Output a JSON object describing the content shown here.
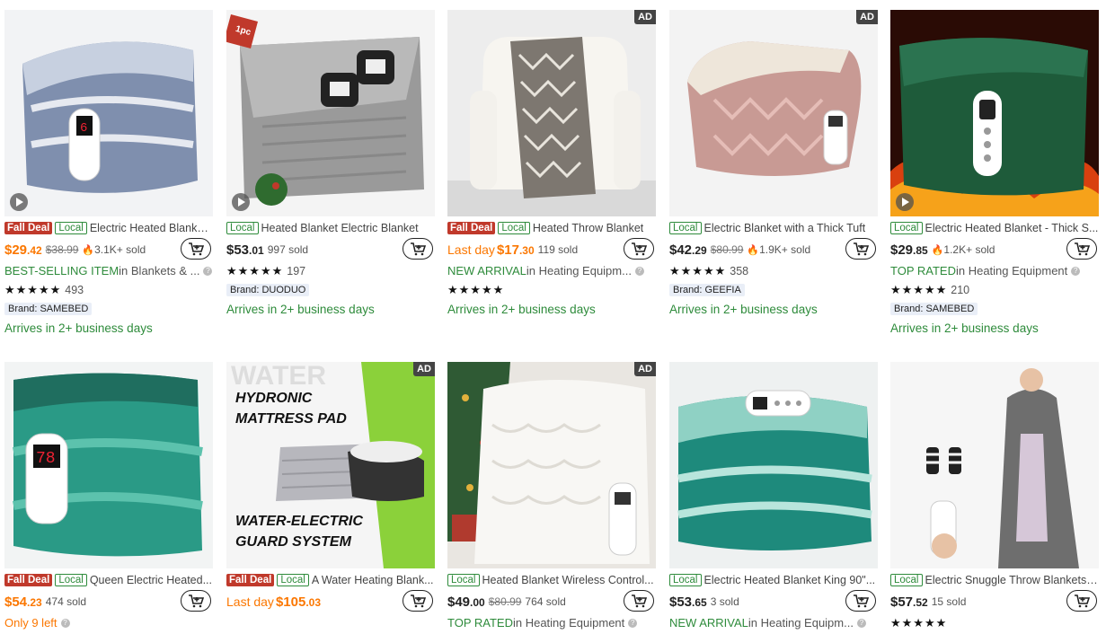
{
  "badges": {
    "fall_deal": "Fall Deal",
    "local": "Local",
    "ad": "AD"
  },
  "products": [
    {
      "title": "Electric Heated Blanket Throw",
      "fall_deal": true,
      "price_main": "$29",
      "price_cents": ".42",
      "orig": "$38.99",
      "fire": true,
      "sold": "3.1K+ sold",
      "tag_strong": "BEST-SELLING ITEM",
      "tag_rest": " in Blankets & ...",
      "stars": "★★★★★",
      "reviews": "493",
      "brand": "Brand: SAMEBED",
      "arrive": "Arrives in 2+ business days",
      "ad": false,
      "play": true
    },
    {
      "title": "Heated Blanket Electric Blanket",
      "fall_deal": false,
      "price_main": "$53",
      "price_cents": ".01",
      "orig": "",
      "fire": false,
      "sold": "997 sold",
      "tag_strong": "",
      "tag_rest": "",
      "stars": "★★★★★",
      "reviews": "197",
      "brand": "Brand: DUODUO",
      "arrive": "Arrives in 2+ business days",
      "ad": false,
      "play": true,
      "sticker": "1pc"
    },
    {
      "title": "Heated Throw Blanket",
      "fall_deal": true,
      "last_day": "Last day",
      "price_main": "$17",
      "price_cents": ".30",
      "orig": "",
      "fire": false,
      "sold": "119 sold",
      "tag_strong": "NEW ARRIVAL",
      "tag_rest": " in Heating Equipm...",
      "stars": "★★★★★",
      "reviews": "",
      "brand": "",
      "arrive": "Arrives in 2+ business days",
      "ad": true,
      "play": false
    },
    {
      "title": "Electric Blanket with a Thick Tuft",
      "fall_deal": false,
      "price_main": "$42",
      "price_cents": ".29",
      "orig": "$80.99",
      "fire": true,
      "sold": "1.9K+ sold",
      "tag_strong": "",
      "tag_rest": "",
      "stars": "★★★★★",
      "reviews": "358",
      "brand": "Brand: GEEFIA",
      "arrive": "Arrives in 2+ business days",
      "ad": true,
      "play": false
    },
    {
      "title": "Electric Heated Blanket - Thick S...",
      "fall_deal": false,
      "price_main": "$29",
      "price_cents": ".85",
      "orig": "",
      "fire": true,
      "sold": "1.2K+ sold",
      "tag_strong": "TOP RATED",
      "tag_rest": " in Heating Equipment",
      "stars": "★★★★★",
      "reviews": "210",
      "brand": "Brand: SAMEBED",
      "arrive": "Arrives in 2+ business days",
      "ad": false,
      "play": true
    },
    {
      "title": "Queen Electric Heated...",
      "fall_deal": true,
      "price_main": "$54",
      "price_cents": ".23",
      "orig": "",
      "fire": false,
      "sold": "474 sold",
      "tag_strong": "Only 9 left",
      "tag_rest": "",
      "ad": false,
      "play": false
    },
    {
      "title": "A Water Heating Blank...",
      "fall_deal": true,
      "last_day": "Last day",
      "price_main": "$105",
      "price_cents": ".03",
      "orig": "",
      "fire": false,
      "sold": "",
      "ad": true,
      "play": false,
      "img_text": [
        "HYDRONIC",
        "MATTRESS PAD",
        "WATER-ELECTRIC",
        "GUARD SYSTEM",
        "WATER"
      ]
    },
    {
      "title": "Heated Blanket Wireless Control...",
      "fall_deal": false,
      "price_main": "$49",
      "price_cents": ".00",
      "orig": "$80.99",
      "fire": false,
      "sold": "764 sold",
      "tag_strong": "TOP RATED",
      "tag_rest": " in Heating Equipment",
      "ad": true,
      "play": false
    },
    {
      "title": "Electric Heated Blanket King 90\"...",
      "fall_deal": false,
      "price_main": "$53",
      "price_cents": ".65",
      "orig": "",
      "fire": false,
      "sold": "3 sold",
      "tag_strong": "NEW ARRIVAL",
      "tag_rest": " in Heating Equipm...",
      "ad": false,
      "play": false
    },
    {
      "title": "Electric Snuggle Throw Blankets ...",
      "fall_deal": false,
      "price_main": "$57",
      "price_cents": ".52",
      "orig": "",
      "fire": false,
      "sold": "15 sold",
      "stars": "★★★★★",
      "ad": false,
      "play": false
    }
  ],
  "colors": {
    "accent": "#fb7701",
    "green": "#2e8b3b",
    "fall_deal": "#c0392b"
  }
}
